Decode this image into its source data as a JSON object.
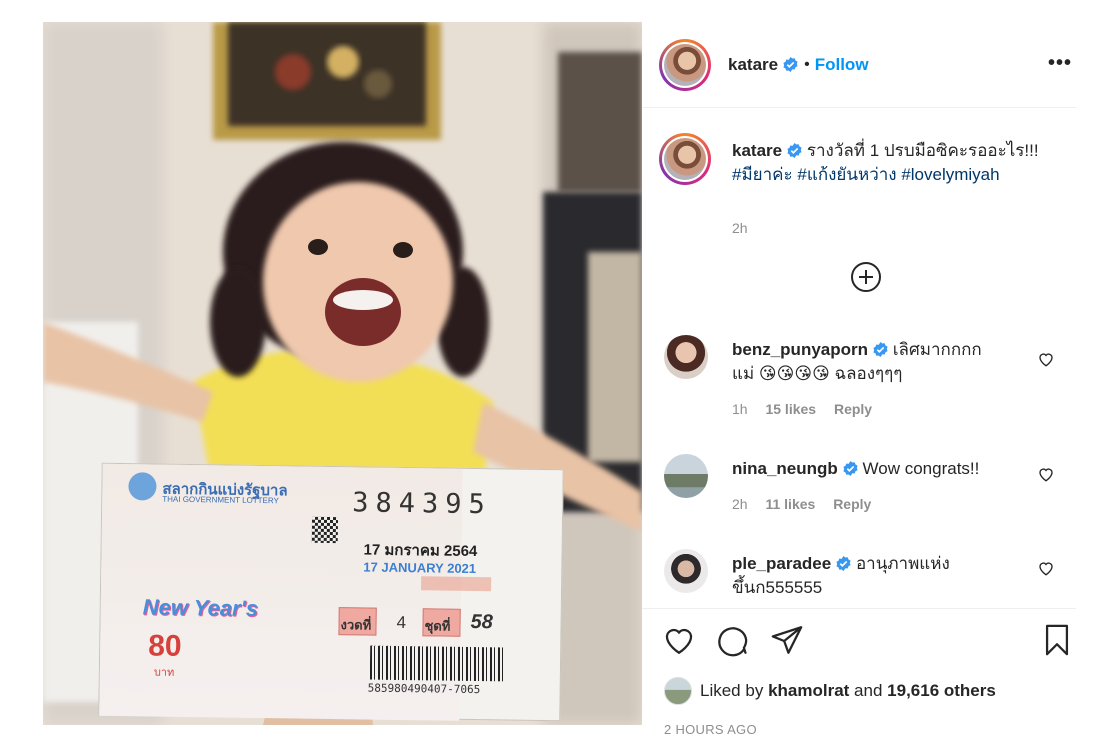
{
  "post": {
    "username": "katare",
    "follow_label": "Follow",
    "separator": "•",
    "more_label": "•••"
  },
  "caption": {
    "username": "katare",
    "text": "รางวัลที่ 1 ปรบมือซิคะรออะไร!!!",
    "hashtags": [
      "#มียาค่ะ",
      "#แก้งยันหว่าง",
      "#lovelymiyah"
    ],
    "time": "2h"
  },
  "comments": [
    {
      "username": "benz_punyaporn",
      "text_line1": "เลิศมากกกก",
      "text_line2_prefix": "แม่",
      "emojis": "😘😘😘😘",
      "text_line2_suffix": "ฉลองๆๆๆ",
      "time": "1h",
      "likes": "15 likes",
      "reply": "Reply"
    },
    {
      "username": "nina_neungb",
      "text": "Wow congrats!!",
      "time": "2h",
      "likes": "11 likes",
      "reply": "Reply"
    },
    {
      "username": "ple_paradee",
      "text_line1": "อานุภาพแห่ง",
      "text_line2": "ขึ้นก555555"
    }
  ],
  "likes": {
    "prefix": "Liked by",
    "user": "khamolrat",
    "connector": "and",
    "others": "19,616 others"
  },
  "posted_ago": "2 HOURS AGO",
  "ticket": {
    "number": "384395",
    "date_th": "17 มกราคม 2564",
    "date_en": "17 JANUARY 2021",
    "period_label": "งวดที่",
    "period": "4",
    "set_label": "ชุดที่",
    "set": "58",
    "price": "80",
    "barcode_text": "585980490407-7065",
    "header_th": "สลากกินแบ่งรัฐบาล",
    "header_en": "THAI GOVERNMENT LOTTERY",
    "banner": "New Year's",
    "price_unit": "บาท"
  },
  "colors": {
    "accent": "#0095f6",
    "verified": "#3897f0",
    "hashtag": "#00376b"
  }
}
